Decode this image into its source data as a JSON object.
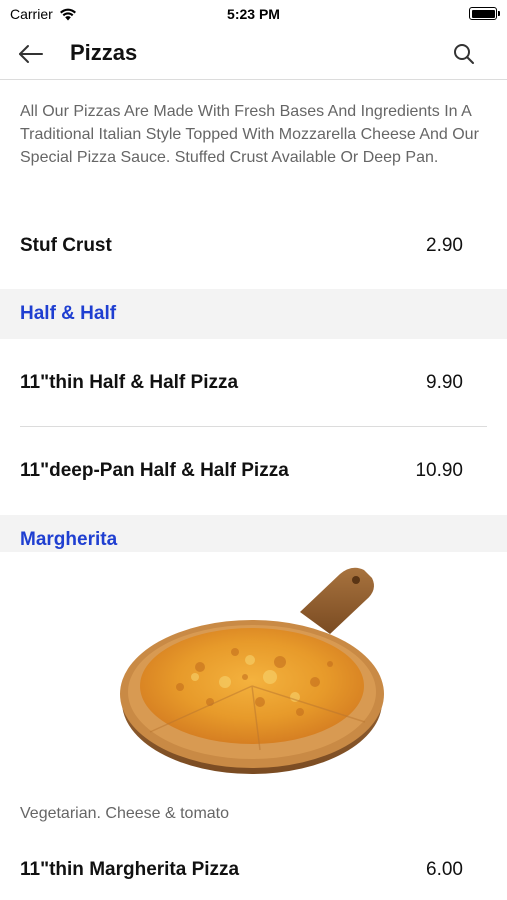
{
  "status": {
    "carrier": "Carrier",
    "time": "5:23 PM"
  },
  "nav": {
    "title": "Pizzas"
  },
  "intro": "All Our Pizzas Are Made With Fresh Bases And Ingredients In A Traditional Italian Style Topped With Mozzarella Cheese And Our Special Pizza Sauce. Stuffed Crust Available Or Deep Pan.",
  "items": [
    {
      "name": "Stuf Crust",
      "price": "2.90"
    }
  ],
  "sections": [
    {
      "title": "Half & Half",
      "items": [
        {
          "name": "11\"thin Half & Half Pizza",
          "price": "9.90"
        },
        {
          "name": "11\"deep-Pan Half & Half Pizza",
          "price": "10.90"
        }
      ]
    },
    {
      "title": "Margherita",
      "note": "Vegetarian. Cheese & tomato",
      "items": [
        {
          "name": "11\"thin Margherita Pizza",
          "price": "6.00"
        }
      ]
    }
  ],
  "colors": {
    "section_title": "#1f3fd1",
    "section_bg": "#f3f3f3",
    "description": "#666666"
  },
  "icons": [
    "wifi-icon",
    "battery-icon",
    "back-arrow-icon",
    "search-icon"
  ]
}
